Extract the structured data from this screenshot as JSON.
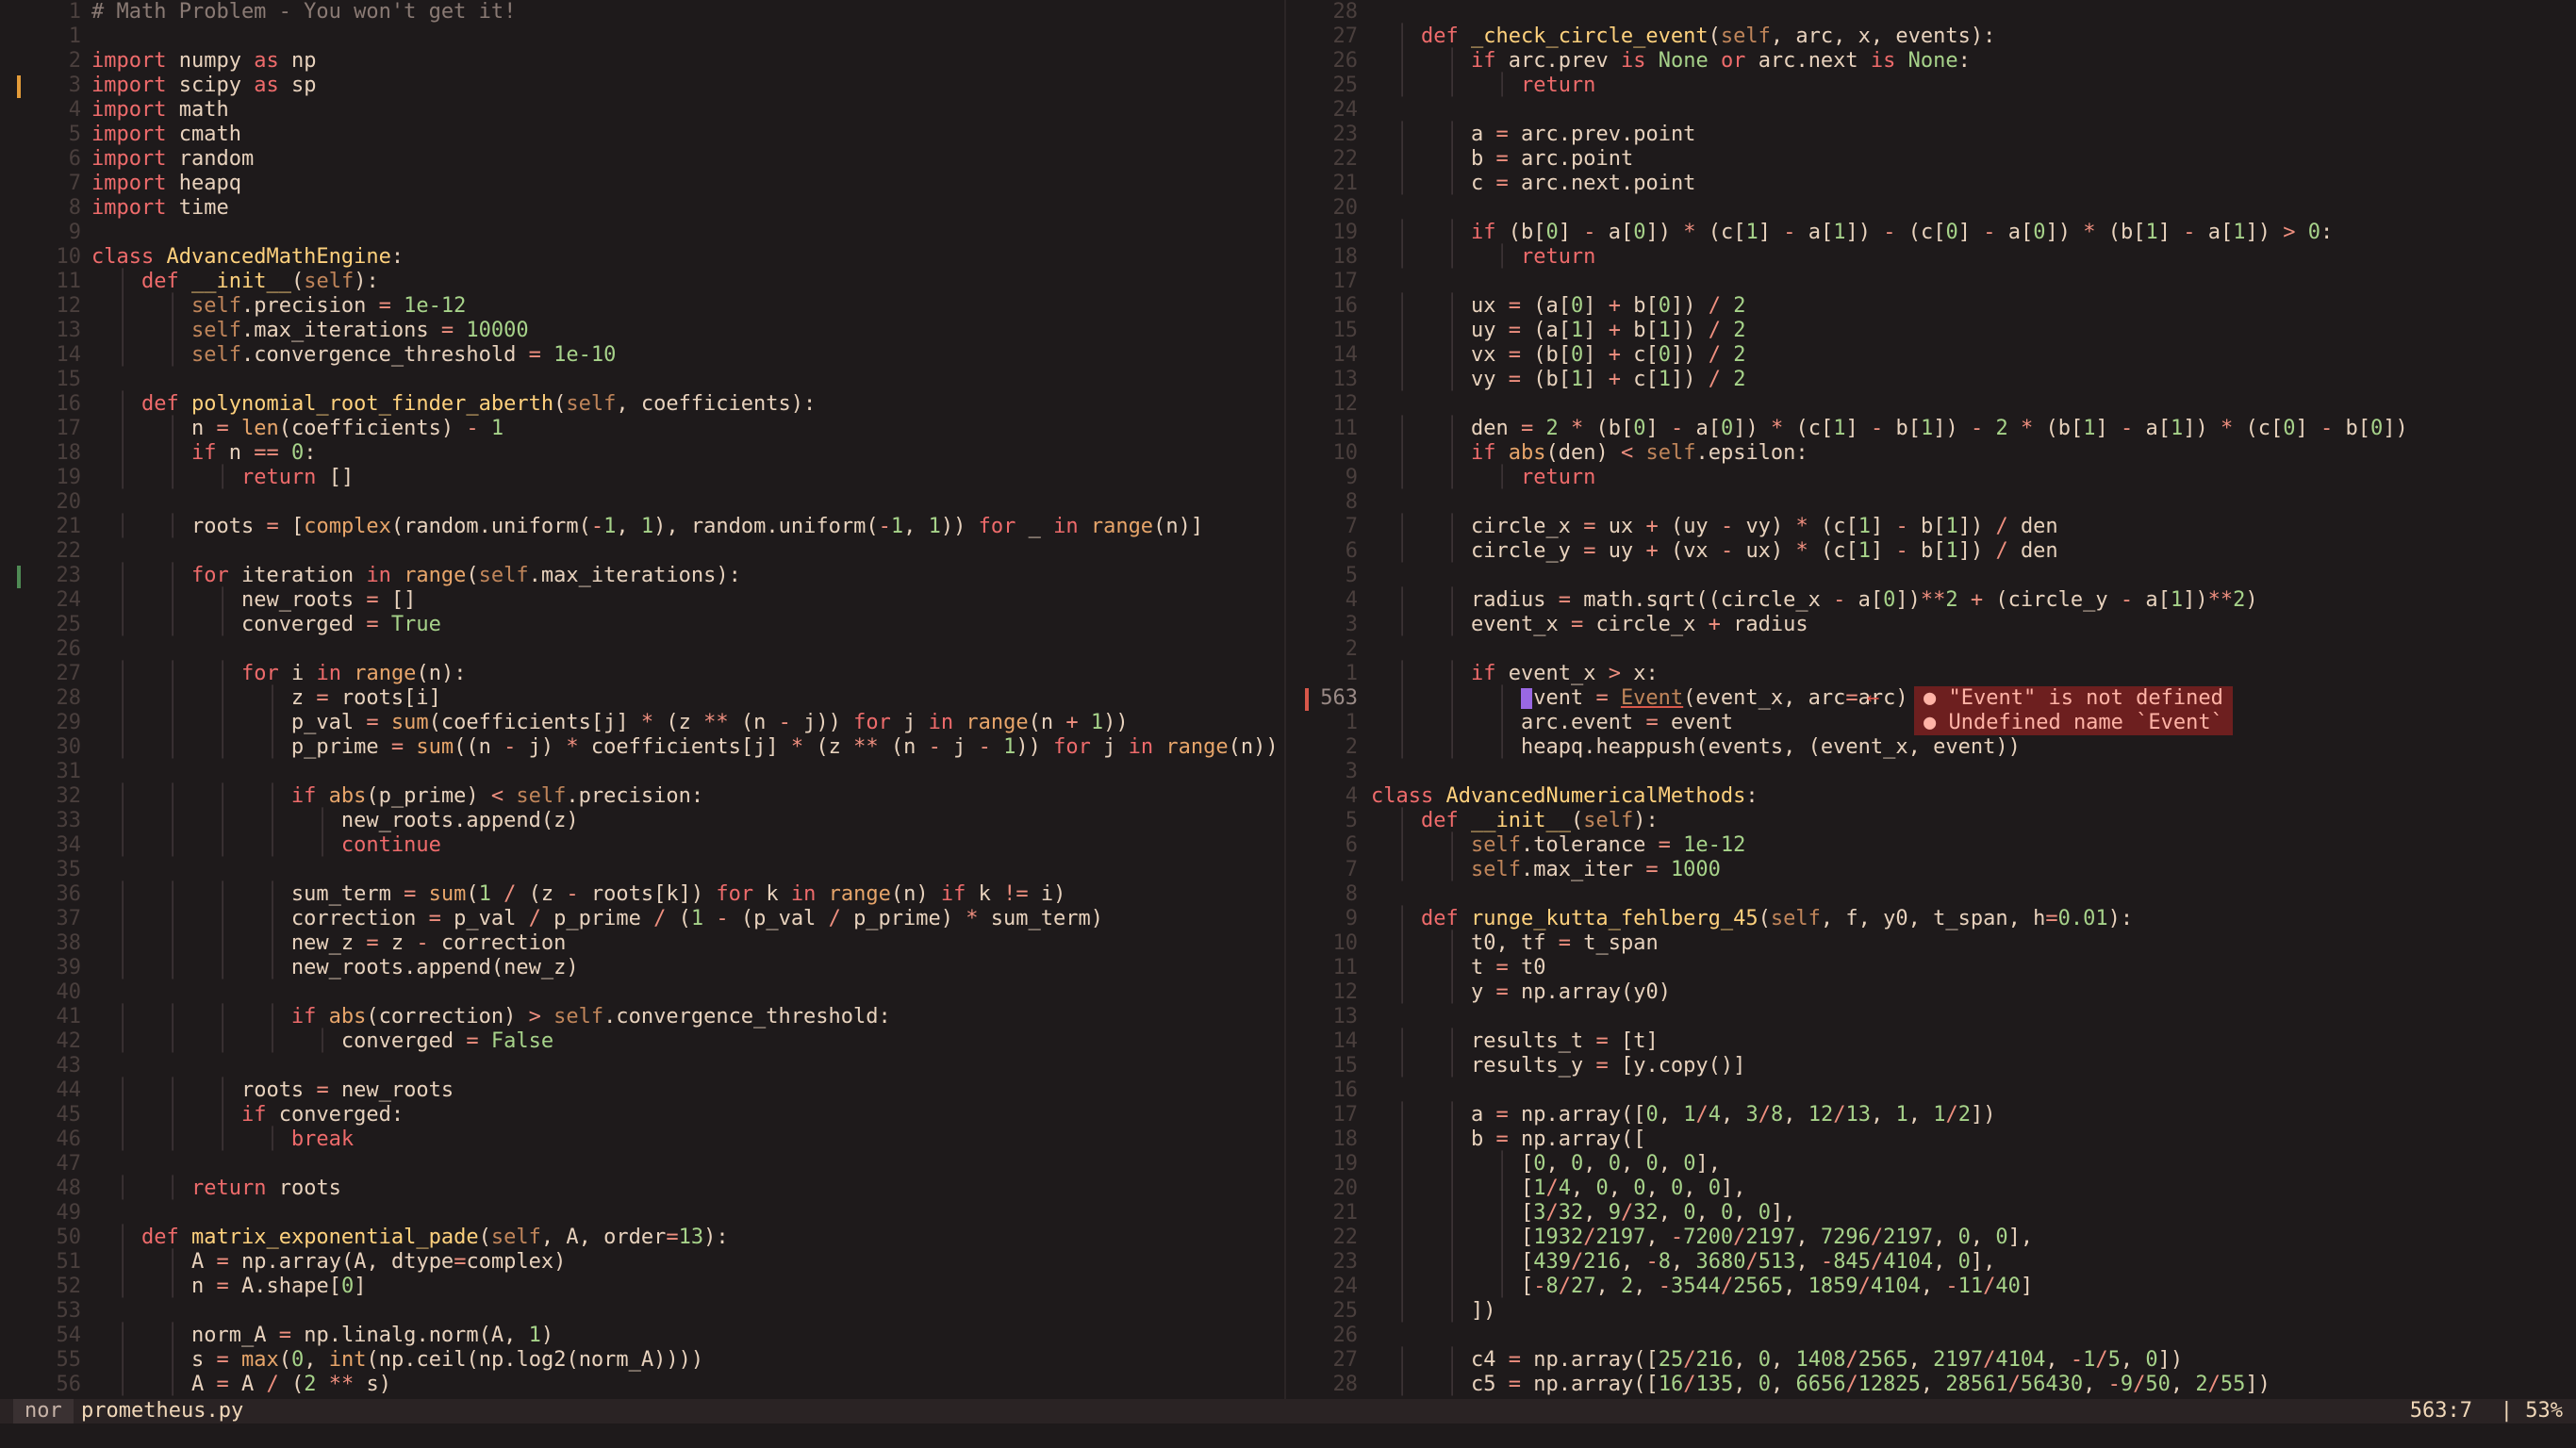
{
  "theme": {
    "background": "#1e1a1b",
    "default": "#e8d2bd",
    "keyword": "#ee6b6b",
    "builtin": "#e7a56a",
    "function": "#ffd17d",
    "number": "#a7d38a",
    "string": "#a7d38a",
    "self": "#c0855a",
    "comment": "#8a7a74",
    "operator": "#ef8f7f",
    "class": "#ffd17d",
    "indent": "#3c3335",
    "error": "#d8574a",
    "sign_modified": "#e39b39",
    "sign_added": "#4f8a54",
    "sign_error": "#d8574a",
    "cursor": "#9a68e3"
  },
  "left_pane": {
    "lines": [
      {
        "n": "1",
        "t": "# Math Problem - You won't get it!"
      },
      {
        "n": "1",
        "t": ""
      },
      {
        "n": "2",
        "t": "import numpy as np"
      },
      {
        "n": "3",
        "t": "import scipy as sp",
        "sign": "modified"
      },
      {
        "n": "4",
        "t": "import math"
      },
      {
        "n": "5",
        "t": "import cmath"
      },
      {
        "n": "6",
        "t": "import random"
      },
      {
        "n": "7",
        "t": "import heapq"
      },
      {
        "n": "8",
        "t": "import time"
      },
      {
        "n": "9",
        "t": ""
      },
      {
        "n": "10",
        "t": "class AdvancedMathEngine:"
      },
      {
        "n": "11",
        "t": "    def __init__(self):"
      },
      {
        "n": "12",
        "t": "        self.precision = 1e-12"
      },
      {
        "n": "13",
        "t": "        self.max_iterations = 10000"
      },
      {
        "n": "14",
        "t": "        self.convergence_threshold = 1e-10"
      },
      {
        "n": "15",
        "t": ""
      },
      {
        "n": "16",
        "t": "    def polynomial_root_finder_aberth(self, coefficients):"
      },
      {
        "n": "17",
        "t": "        n = len(coefficients) - 1"
      },
      {
        "n": "18",
        "t": "        if n == 0:"
      },
      {
        "n": "19",
        "t": "            return []"
      },
      {
        "n": "20",
        "t": ""
      },
      {
        "n": "21",
        "t": "        roots = [complex(random.uniform(-1, 1), random.uniform(-1, 1)) for _ in range(n)]"
      },
      {
        "n": "22",
        "t": ""
      },
      {
        "n": "23",
        "t": "        for iteration in range(self.max_iterations):",
        "sign": "added"
      },
      {
        "n": "24",
        "t": "            new_roots = []"
      },
      {
        "n": "25",
        "t": "            converged = True"
      },
      {
        "n": "26",
        "t": ""
      },
      {
        "n": "27",
        "t": "            for i in range(n):"
      },
      {
        "n": "28",
        "t": "                z = roots[i]"
      },
      {
        "n": "29",
        "t": "                p_val = sum(coefficients[j] * (z ** (n - j)) for j in range(n + 1))"
      },
      {
        "n": "30",
        "t": "                p_prime = sum((n - j) * coefficients[j] * (z ** (n - j - 1)) for j in range(n))"
      },
      {
        "n": "31",
        "t": ""
      },
      {
        "n": "32",
        "t": "                if abs(p_prime) < self.precision:"
      },
      {
        "n": "33",
        "t": "                    new_roots.append(z)"
      },
      {
        "n": "34",
        "t": "                    continue"
      },
      {
        "n": "35",
        "t": ""
      },
      {
        "n": "36",
        "t": "                sum_term = sum(1 / (z - roots[k]) for k in range(n) if k != i)"
      },
      {
        "n": "37",
        "t": "                correction = p_val / p_prime / (1 - (p_val / p_prime) * sum_term)"
      },
      {
        "n": "38",
        "t": "                new_z = z - correction"
      },
      {
        "n": "39",
        "t": "                new_roots.append(new_z)"
      },
      {
        "n": "40",
        "t": ""
      },
      {
        "n": "41",
        "t": "                if abs(correction) > self.convergence_threshold:"
      },
      {
        "n": "42",
        "t": "                    converged = False"
      },
      {
        "n": "43",
        "t": ""
      },
      {
        "n": "44",
        "t": "            roots = new_roots"
      },
      {
        "n": "45",
        "t": "            if converged:"
      },
      {
        "n": "46",
        "t": "                break"
      },
      {
        "n": "47",
        "t": ""
      },
      {
        "n": "48",
        "t": "        return roots"
      },
      {
        "n": "49",
        "t": ""
      },
      {
        "n": "50",
        "t": "    def matrix_exponential_pade(self, A, order=13):"
      },
      {
        "n": "51",
        "t": "        A = np.array(A, dtype=complex)"
      },
      {
        "n": "52",
        "t": "        n = A.shape[0]"
      },
      {
        "n": "53",
        "t": ""
      },
      {
        "n": "54",
        "t": "        norm_A = np.linalg.norm(A, 1)"
      },
      {
        "n": "55",
        "t": "        s = max(0, int(np.ceil(np.log2(norm_A))))"
      },
      {
        "n": "56",
        "t": "        A = A / (2 ** s)"
      }
    ]
  },
  "right_pane": {
    "lines": [
      {
        "n": "28",
        "t": ""
      },
      {
        "n": "27",
        "t": "    def _check_circle_event(self, arc, x, events):"
      },
      {
        "n": "26",
        "t": "        if arc.prev is None or arc.next is None:"
      },
      {
        "n": "25",
        "t": "            return"
      },
      {
        "n": "24",
        "t": ""
      },
      {
        "n": "23",
        "t": "        a = arc.prev.point"
      },
      {
        "n": "22",
        "t": "        b = arc.point"
      },
      {
        "n": "21",
        "t": "        c = arc.next.point"
      },
      {
        "n": "20",
        "t": ""
      },
      {
        "n": "19",
        "t": "        if (b[0] - a[0]) * (c[1] - a[1]) - (c[0] - a[0]) * (b[1] - a[1]) > 0:"
      },
      {
        "n": "18",
        "t": "            return"
      },
      {
        "n": "17",
        "t": ""
      },
      {
        "n": "16",
        "t": "        ux = (a[0] + b[0]) / 2"
      },
      {
        "n": "15",
        "t": "        uy = (a[1] + b[1]) / 2"
      },
      {
        "n": "14",
        "t": "        vx = (b[0] + c[0]) / 2"
      },
      {
        "n": "13",
        "t": "        vy = (b[1] + c[1]) / 2"
      },
      {
        "n": "12",
        "t": ""
      },
      {
        "n": "11",
        "t": "        den = 2 * (b[0] - a[0]) * (c[1] - b[1]) - 2 * (b[1] - a[1]) * (c[0] - b[0])"
      },
      {
        "n": "10",
        "t": "        if abs(den) < self.epsilon:"
      },
      {
        "n": "9",
        "t": "            return"
      },
      {
        "n": "8",
        "t": ""
      },
      {
        "n": "7",
        "t": "        circle_x = ux + (uy - vy) * (c[1] - b[1]) / den"
      },
      {
        "n": "6",
        "t": "        circle_y = uy + (vx - ux) * (c[1] - b[1]) / den"
      },
      {
        "n": "5",
        "t": ""
      },
      {
        "n": "4",
        "t": "        radius = math.sqrt((circle_x - a[0])**2 + (circle_y - a[1])**2)"
      },
      {
        "n": "3",
        "t": "        event_x = circle_x + radius"
      },
      {
        "n": "2",
        "t": ""
      },
      {
        "n": "1",
        "t": "        if event_x > x:"
      },
      {
        "n": "563",
        "t": "            event = Event(event_x, arc=arc)",
        "sign": "error",
        "current": true,
        "diag": [
          "● \"Event\" is not defined",
          "● Undefined name `Event`"
        ]
      },
      {
        "n": "1",
        "t": "            arc.event = event"
      },
      {
        "n": "2",
        "t": "            heapq.heappush(events, (event_x, event))"
      },
      {
        "n": "3",
        "t": ""
      },
      {
        "n": "4",
        "t": "class AdvancedNumericalMethods:"
      },
      {
        "n": "5",
        "t": "    def __init__(self):"
      },
      {
        "n": "6",
        "t": "        self.tolerance = 1e-12"
      },
      {
        "n": "7",
        "t": "        self.max_iter = 1000"
      },
      {
        "n": "8",
        "t": ""
      },
      {
        "n": "9",
        "t": "    def runge_kutta_fehlberg_45(self, f, y0, t_span, h=0.01):"
      },
      {
        "n": "10",
        "t": "        t0, tf = t_span"
      },
      {
        "n": "11",
        "t": "        t = t0"
      },
      {
        "n": "12",
        "t": "        y = np.array(y0)"
      },
      {
        "n": "13",
        "t": ""
      },
      {
        "n": "14",
        "t": "        results_t = [t]"
      },
      {
        "n": "15",
        "t": "        results_y = [y.copy()]"
      },
      {
        "n": "16",
        "t": ""
      },
      {
        "n": "17",
        "t": "        a = np.array([0, 1/4, 3/8, 12/13, 1, 1/2])"
      },
      {
        "n": "18",
        "t": "        b = np.array(["
      },
      {
        "n": "19",
        "t": "            [0, 0, 0, 0, 0],"
      },
      {
        "n": "20",
        "t": "            [1/4, 0, 0, 0, 0],"
      },
      {
        "n": "21",
        "t": "            [3/32, 9/32, 0, 0, 0],"
      },
      {
        "n": "22",
        "t": "            [1932/2197, -7200/2197, 7296/2197, 0, 0],"
      },
      {
        "n": "23",
        "t": "            [439/216, -8, 3680/513, -845/4104, 0],"
      },
      {
        "n": "24",
        "t": "            [-8/27, 2, -3544/2565, 1859/4104, -11/40]"
      },
      {
        "n": "25",
        "t": "        ])"
      },
      {
        "n": "26",
        "t": ""
      },
      {
        "n": "27",
        "t": "        c4 = np.array([25/216, 0, 1408/2565, 2197/4104, -1/5, 0])"
      },
      {
        "n": "28",
        "t": "        c5 = np.array([16/135, 0, 6656/12825, 28561/56430, -9/50, 2/55])"
      }
    ]
  },
  "statusbar": {
    "mode": "nor",
    "filename": "prometheus.py",
    "position": "563:7",
    "percent": "| 53%"
  },
  "diagnostic_arrow": "←"
}
